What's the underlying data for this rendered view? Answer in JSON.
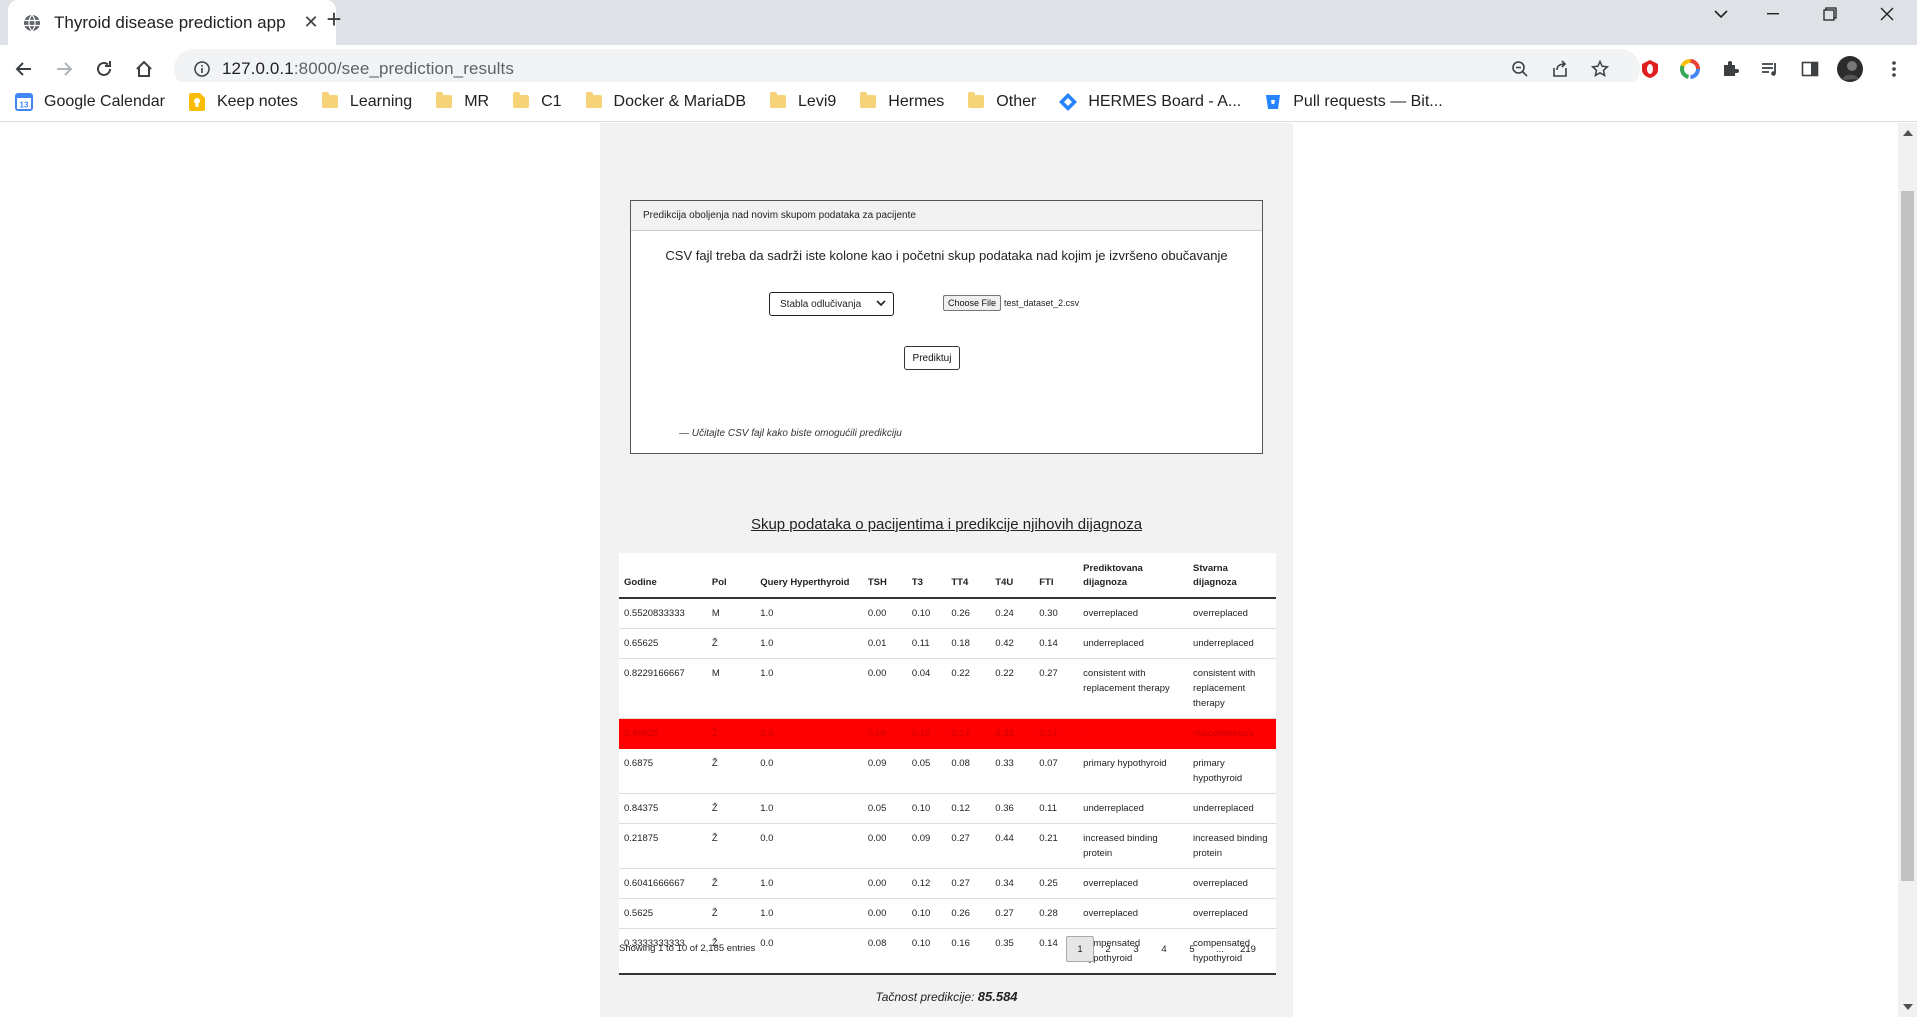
{
  "browser": {
    "tab_title": "Thyroid disease prediction app",
    "url_host": "127.0.0.1",
    "url_path": ":8000/see_prediction_results",
    "bookmarks": [
      {
        "label": "Google Calendar",
        "icon": "calendar-icon"
      },
      {
        "label": "Keep notes",
        "icon": "keep-icon"
      },
      {
        "label": "Learning",
        "icon": "folder-icon"
      },
      {
        "label": "MR",
        "icon": "folder-icon"
      },
      {
        "label": "C1",
        "icon": "folder-icon"
      },
      {
        "label": "Docker & MariaDB",
        "icon": "folder-icon"
      },
      {
        "label": "Levi9",
        "icon": "folder-icon"
      },
      {
        "label": "Hermes",
        "icon": "folder-icon"
      },
      {
        "label": "Other",
        "icon": "folder-icon"
      },
      {
        "label": "HERMES Board - A...",
        "icon": "jira-icon"
      },
      {
        "label": "Pull requests — Bit...",
        "icon": "bitbucket-icon"
      }
    ]
  },
  "form": {
    "header": "Predikcija oboljenja nad novim skupom podataka za pacijente",
    "instruction": "CSV fajl treba da sadrži iste kolone kao i početni skup podataka nad kojim je izvršeno obučavanje",
    "model_select": "Stabla odlučivanja",
    "file_button": "Choose File",
    "file_name": "test_dataset_2.csv",
    "predict_button": "Prediktuj",
    "footnote": "— Učitajte CSV fajl kako biste omogućili predikciju"
  },
  "table": {
    "title": "Skup podataka o pacijentima i predikcije njihovih dijagnoza",
    "columns": [
      "Godine",
      "Pol",
      "Query Hyperthyroid",
      "TSH",
      "T3",
      "TT4",
      "T4U",
      "FTI",
      "Prediktovana dijagnoza",
      "Stvarna dijagnoza"
    ],
    "rows": [
      [
        "0.5520833333",
        "M",
        "1.0",
        "0.00",
        "0.10",
        "0.26",
        "0.24",
        "0.30",
        "overreplaced",
        "overreplaced"
      ],
      [
        "0.65625",
        "Ž",
        "1.0",
        "0.01",
        "0.11",
        "0.18",
        "0.42",
        "0.14",
        "underreplaced",
        "underreplaced"
      ],
      [
        "0.8229166667",
        "M",
        "1.0",
        "0.00",
        "0.04",
        "0.22",
        "0.22",
        "0.27",
        "consistent with replacement therapy",
        "consistent with replacement therapy"
      ],
      [
        "0.40625",
        "Ž",
        "0.0",
        "0.00",
        "0.10",
        "0.17",
        "0.32",
        "0.17",
        "-",
        "miscellaneous"
      ],
      [
        "0.6875",
        "Ž",
        "0.0",
        "0.09",
        "0.05",
        "0.08",
        "0.33",
        "0.07",
        "primary hypothyroid",
        "primary hypothyroid"
      ],
      [
        "0.84375",
        "Ž",
        "1.0",
        "0.05",
        "0.10",
        "0.12",
        "0.36",
        "0.11",
        "underreplaced",
        "underreplaced"
      ],
      [
        "0.21875",
        "Ž",
        "0.0",
        "0.00",
        "0.09",
        "0.27",
        "0.44",
        "0.21",
        "increased binding protein",
        "increased binding protein"
      ],
      [
        "0.6041666667",
        "Ž",
        "1.0",
        "0.00",
        "0.12",
        "0.27",
        "0.34",
        "0.25",
        "overreplaced",
        "overreplaced"
      ],
      [
        "0.5625",
        "Ž",
        "1.0",
        "0.00",
        "0.10",
        "0.26",
        "0.27",
        "0.28",
        "overreplaced",
        "overreplaced"
      ],
      [
        "0.3333333333",
        "Ž",
        "0.0",
        "0.08",
        "0.10",
        "0.16",
        "0.35",
        "0.14",
        "compensated hypothyroid",
        "compensated hypothyroid"
      ]
    ],
    "highlight_row_index": 3,
    "highlight_color": "#ff0000",
    "showing_text": "Showing 1 to 10 of 2,185 entries",
    "pages": [
      "1",
      "2",
      "3",
      "4",
      "5",
      "...",
      "219"
    ],
    "active_page": "1"
  },
  "accuracy": {
    "label": "Tačnost predikcije:",
    "value": "85.584"
  }
}
